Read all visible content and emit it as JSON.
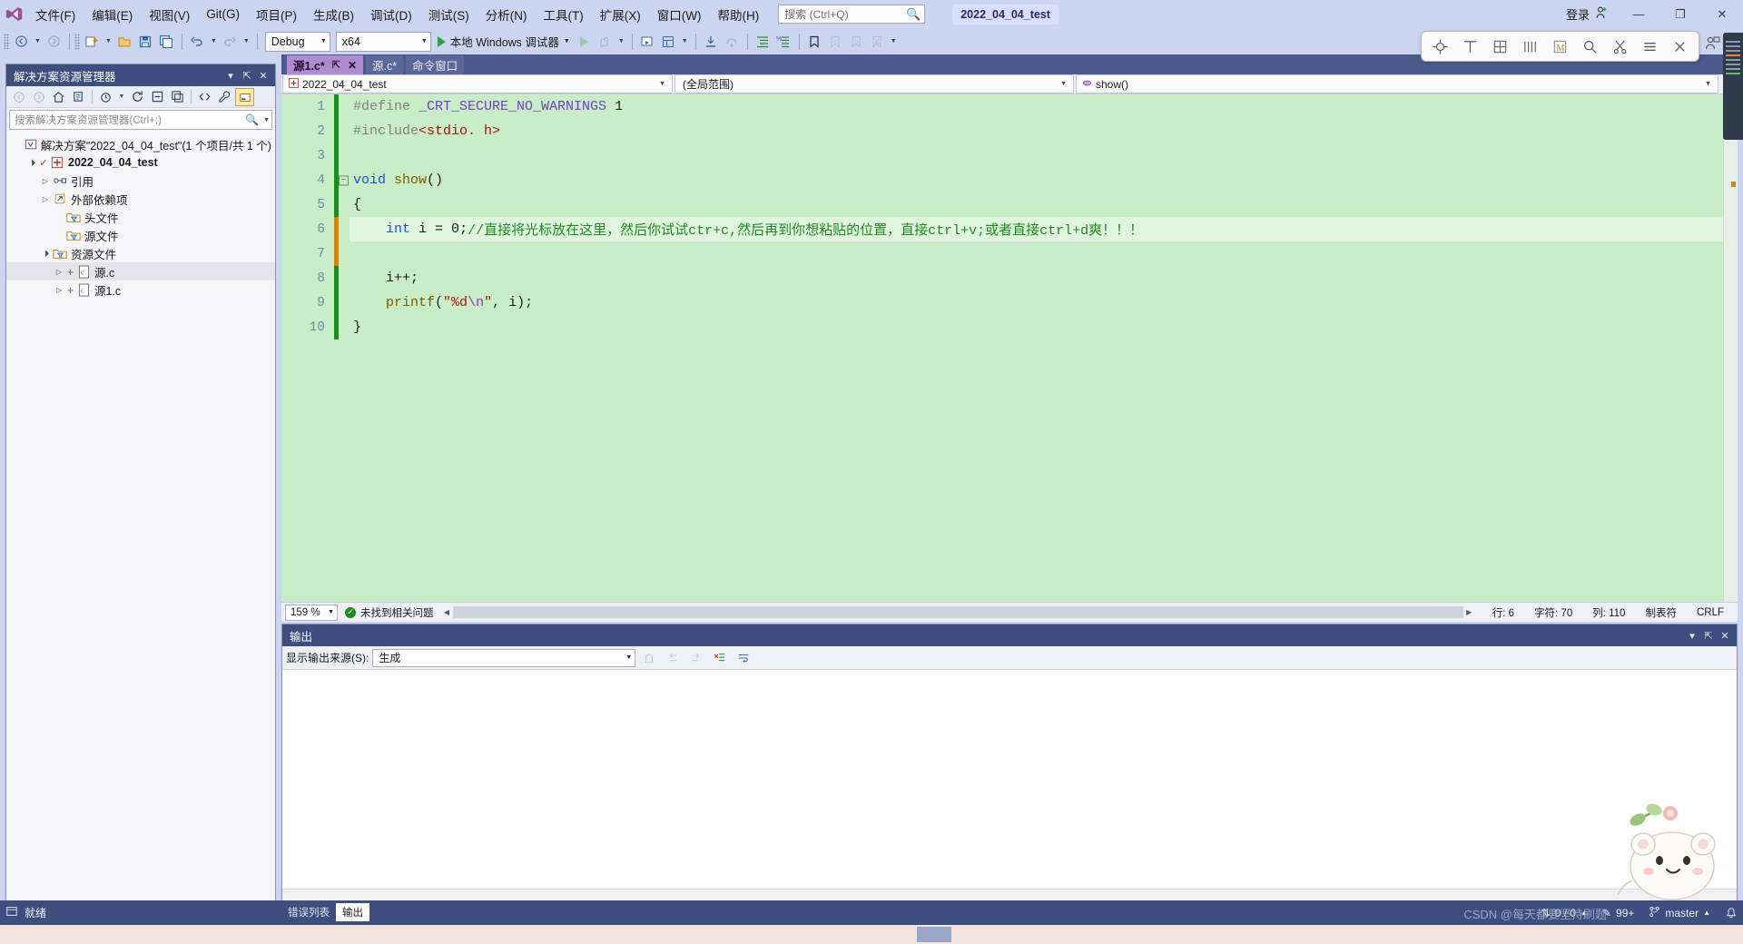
{
  "app": {
    "project_chip": "2022_04_04_test",
    "signin_label": "登录"
  },
  "menu": {
    "items": [
      {
        "label": "文件(F)",
        "name": "menu-file"
      },
      {
        "label": "编辑(E)",
        "name": "menu-edit"
      },
      {
        "label": "视图(V)",
        "name": "menu-view"
      },
      {
        "label": "Git(G)",
        "name": "menu-git"
      },
      {
        "label": "项目(P)",
        "name": "menu-project"
      },
      {
        "label": "生成(B)",
        "name": "menu-build"
      },
      {
        "label": "调试(D)",
        "name": "menu-debug"
      },
      {
        "label": "测试(S)",
        "name": "menu-test"
      },
      {
        "label": "分析(N)",
        "name": "menu-analyze"
      },
      {
        "label": "工具(T)",
        "name": "menu-tools"
      },
      {
        "label": "扩展(X)",
        "name": "menu-extensions"
      },
      {
        "label": "窗口(W)",
        "name": "menu-window"
      },
      {
        "label": "帮助(H)",
        "name": "menu-help"
      }
    ]
  },
  "search": {
    "placeholder": "搜索 (Ctrl+Q)"
  },
  "window_buttons": {
    "minimize": "—",
    "maximize": "❐",
    "close": "✕"
  },
  "toolbar": {
    "config": "Debug",
    "platform": "x64",
    "run_label": "本地 Windows 调试器"
  },
  "minibar": {
    "icons": [
      "crosshair-icon",
      "text-tool-icon",
      "grid-icon",
      "columns-icon",
      "magnifier-m-icon",
      "search-icon",
      "scissors-icon",
      "menu-icon",
      "close-icon"
    ]
  },
  "solution_explorer": {
    "title": "解决方案资源管理器",
    "search_placeholder": "搜索解决方案资源管理器(Ctrl+;)",
    "tree": [
      {
        "label": "解决方案\"2022_04_04_test\"(1 个项目/共 1 个)",
        "indent": 0,
        "icon": "solution-icon",
        "expander": "",
        "bold": false,
        "selected": false
      },
      {
        "label": "2022_04_04_test",
        "indent": 1,
        "icon": "project-icon",
        "expander": "▲",
        "bold": true,
        "selected": false
      },
      {
        "label": "引用",
        "indent": 2,
        "icon": "references-icon",
        "expander": "▶",
        "bold": false,
        "selected": false
      },
      {
        "label": "外部依赖项",
        "indent": 2,
        "icon": "external-deps-icon",
        "expander": "▶",
        "bold": false,
        "selected": false
      },
      {
        "label": "头文件",
        "indent": 3,
        "icon": "filter-folder-icon",
        "expander": "",
        "bold": false,
        "selected": false
      },
      {
        "label": "源文件",
        "indent": 3,
        "icon": "filter-folder-icon",
        "expander": "",
        "bold": false,
        "selected": false
      },
      {
        "label": "资源文件",
        "indent": 2,
        "icon": "filter-folder-icon",
        "expander": "▲",
        "bold": false,
        "selected": false
      },
      {
        "label": "源.c",
        "indent": 3,
        "icon": "c-file-icon",
        "expander": "▶",
        "bold": false,
        "selected": true
      },
      {
        "label": "源1.c",
        "indent": 3,
        "icon": "c-file-icon",
        "expander": "▶",
        "bold": false,
        "selected": false
      }
    ]
  },
  "editor": {
    "tabs": [
      {
        "label": "源1.c*",
        "active": true
      },
      {
        "label": "源.c*",
        "active": false
      },
      {
        "label": "命令窗口",
        "active": false
      }
    ],
    "navbar": {
      "project": "2022_04_04_test",
      "scope": "(全局范围)",
      "member": "show()"
    },
    "lines": [
      {
        "n": "1",
        "change": "green",
        "fold": "",
        "tokens": [
          {
            "t": "#define ",
            "c": "c-pre"
          },
          {
            "t": "_CRT_SECURE_NO_WARNINGS",
            "c": "c-macro"
          },
          {
            "t": " 1",
            "c": "c-num"
          }
        ]
      },
      {
        "n": "2",
        "change": "green",
        "fold": "",
        "tokens": [
          {
            "t": "#include",
            "c": "c-pre"
          },
          {
            "t": "<stdio. h>",
            "c": "c-str"
          }
        ]
      },
      {
        "n": "3",
        "change": "green",
        "fold": "",
        "tokens": []
      },
      {
        "n": "4",
        "change": "green",
        "fold": "−",
        "tokens": [
          {
            "t": "void ",
            "c": "c-kw"
          },
          {
            "t": "show",
            "c": "c-fn"
          },
          {
            "t": "()",
            "c": "c-id"
          }
        ]
      },
      {
        "n": "5",
        "change": "green",
        "fold": "",
        "tokens": [
          {
            "t": "{",
            "c": "c-id"
          }
        ]
      },
      {
        "n": "6",
        "change": "orange",
        "fold": "",
        "current": true,
        "tokens": [
          {
            "t": "    ",
            "c": "c-id"
          },
          {
            "t": "int ",
            "c": "c-kw"
          },
          {
            "t": "i = ",
            "c": "c-id"
          },
          {
            "t": "0",
            "c": "c-num"
          },
          {
            "t": ";",
            "c": "c-id"
          },
          {
            "t": "//直接将光标放在这里，然后你试试ctr+c,然后再到你想粘贴的位置，直接ctrl+v;或者直接ctrl+d爽！！！",
            "c": "c-cmt"
          }
        ]
      },
      {
        "n": "7",
        "change": "orange",
        "fold": "",
        "tokens": []
      },
      {
        "n": "8",
        "change": "green",
        "fold": "",
        "tokens": [
          {
            "t": "    i++;",
            "c": "c-id"
          }
        ]
      },
      {
        "n": "9",
        "change": "green",
        "fold": "",
        "tokens": [
          {
            "t": "    ",
            "c": "c-id"
          },
          {
            "t": "printf",
            "c": "c-fn"
          },
          {
            "t": "(",
            "c": "c-id"
          },
          {
            "t": "\"%d",
            "c": "c-str"
          },
          {
            "t": "\\n",
            "c": "c-esc"
          },
          {
            "t": "\"",
            "c": "c-str"
          },
          {
            "t": ", i);",
            "c": "c-id"
          }
        ]
      },
      {
        "n": "10",
        "change": "green",
        "fold": "",
        "tokens": [
          {
            "t": "}",
            "c": "c-id"
          }
        ]
      }
    ],
    "status": {
      "zoom": "159 %",
      "issues": "未找到相关问题",
      "line": "行: 6",
      "chars": "字符: 70",
      "col": "列: 110",
      "tabs": "制表符",
      "eol": "CRLF"
    }
  },
  "output": {
    "title": "输出",
    "source_label": "显示输出来源(S):",
    "source_value": "生成",
    "doc_tabs": [
      {
        "label": "错误列表",
        "active": false
      },
      {
        "label": "输出",
        "active": true
      }
    ]
  },
  "statusbar": {
    "ready": "就绪",
    "sync": "0 / 0",
    "pending": "99+",
    "branch": "master",
    "watermark": "CSDN @每天都要坚持刷题"
  },
  "colors": {
    "chrome": "#ccd5ef",
    "panel_header": "#3c4f7e",
    "code_bg": "#c9edc6",
    "tab_active": "#b18bd0",
    "accent_green": "#1f8a20",
    "accent_orange": "#c98a12"
  }
}
